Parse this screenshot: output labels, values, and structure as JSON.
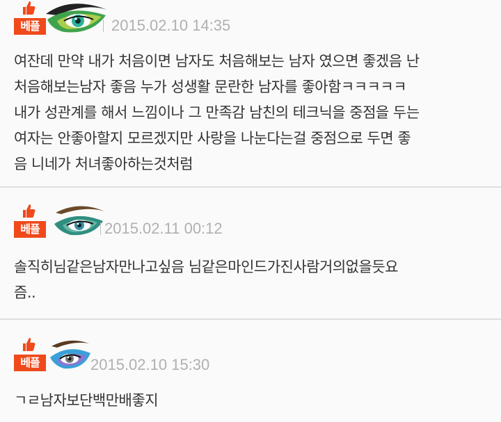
{
  "comments": [
    {
      "badge": "베플",
      "date": "2015.02.10 14:35",
      "text": "여잔데 만약 내가 처음이면 남자도 처음해보는 남자 였으면 좋겠음 난\n처음해보는남자 좋음 누가 성생활 문란한 남자를 좋아함ㅋㅋㅋㅋㅋ\n내가 성관계를 해서 느낌이나 그 만족감 남친의 테크닉을 중점을 두는\n여자는 안좋아할지 모르겠지만 사랑을 나눈다는걸 중점으로 두면 좋\n음 니네가 처녀좋아하는것처럼",
      "eye_colors": {
        "shadow": "#3fa34d",
        "shadow2": "#d8e04a",
        "iris": "#2bb39a"
      }
    },
    {
      "badge": "베플",
      "date": "2015.02.11 00:12",
      "text": "솔직히님같은남자만나고싶음 님같은마인드가진사람거의없을듯요\n즘..",
      "eye_colors": {
        "shadow": "#2f8f7f",
        "shadow2": "#7fc8b8",
        "iris": "#3a8fa0"
      }
    },
    {
      "badge": "베플",
      "date": "2015.02.10 15:30",
      "text": "ㄱㄹ남자보단백만배좋지",
      "eye_colors": {
        "shadow": "#3aa0d8",
        "shadow2": "#a56ad0",
        "iris": "#777777"
      }
    }
  ],
  "colors": {
    "badge": "#f04a1c",
    "date": "#b0b0b0",
    "text": "#333333",
    "divider": "#dedede"
  }
}
